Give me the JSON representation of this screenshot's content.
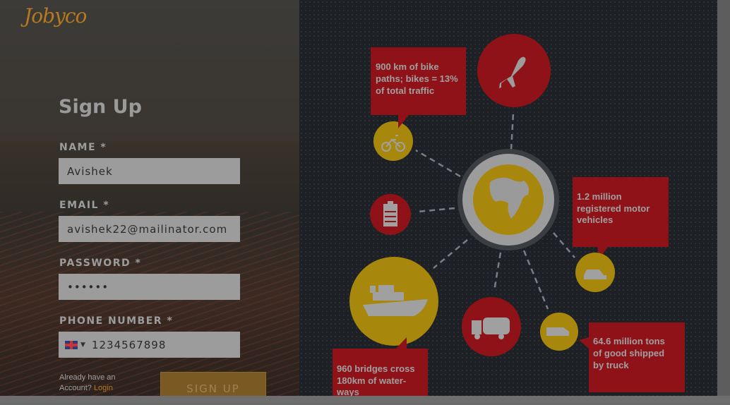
{
  "brand": {
    "logo": "Jobyco"
  },
  "form": {
    "title": "Sign Up",
    "name_label": "NAME *",
    "name_value": "Avishek",
    "email_label": "EMAIL *",
    "email_value": "avishek22@mailinator.com",
    "password_label": "PASSWORD *",
    "password_value": "••••••",
    "phone_label": "PHONE NUMBER *",
    "phone_value": "1234567898",
    "already_text": "Already have an",
    "account_text": "Account?",
    "login_link": "Login",
    "signup_button": "SIGN UP"
  },
  "infographic": {
    "bike_text": [
      "900 km of bike",
      "paths; bikes = 13%",
      "of total traffic"
    ],
    "vehicles_text": [
      "1.2 million",
      "registered motor",
      "vehicles"
    ],
    "truck_text": [
      "64.6 million tons",
      "of good shipped",
      "by truck"
    ],
    "bridges_text": [
      "960 bridges cross",
      "180km of water-",
      "ways"
    ],
    "icons": [
      "airplane-icon",
      "bicycle-icon",
      "battery-icon",
      "globe-icon",
      "car-icon",
      "ship-icon",
      "truck-icon",
      "van-icon"
    ]
  },
  "colors": {
    "accent": "#b7791f",
    "red": "#a0141c",
    "yellow": "#a8880c",
    "bg_dark": "#1d2024"
  }
}
